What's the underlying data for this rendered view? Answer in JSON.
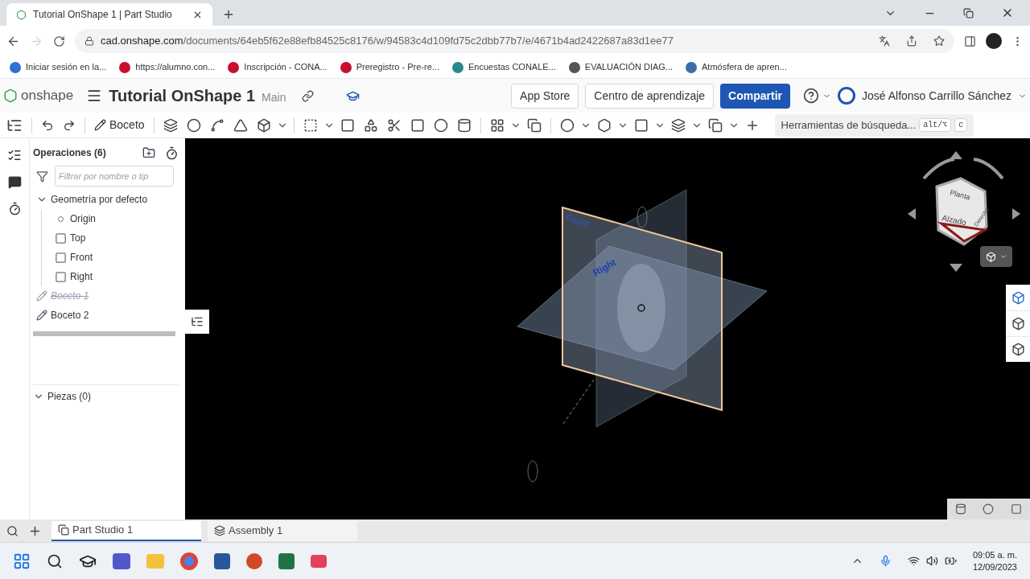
{
  "browser": {
    "tab_title": "Tutorial OnShape 1 | Part Studio",
    "url_host": "cad.onshape.com",
    "url_path": "/documents/64eb5f62e88efb84525c8176/w/94583c4d109fd75c2dbb77b7/e/4671b4ad2422687a83d1ee77",
    "bookmarks": [
      {
        "label": "Iniciar sesión en la...",
        "color": "#2f6fd6"
      },
      {
        "label": "https://alumno.con...",
        "color": "#c8102e"
      },
      {
        "label": "Inscripción - CONA...",
        "color": "#c8102e"
      },
      {
        "label": "Preregistro - Pre-re...",
        "color": "#c8102e"
      },
      {
        "label": "Encuestas CONALE...",
        "color": "#2a8a8a"
      },
      {
        "label": "EVALUACIÓN DIAG...",
        "color": "#555555"
      },
      {
        "label": "Atmósfera de apren...",
        "color": "#3a6ea5"
      }
    ]
  },
  "header": {
    "logo": "onshape",
    "document_title": "Tutorial OnShape 1",
    "branch": "Main",
    "buttons": [
      {
        "label": "App Store",
        "kind": "plain"
      },
      {
        "label": "Centro de aprendizaje",
        "kind": "plain"
      },
      {
        "label": "Compartir",
        "kind": "primary"
      }
    ],
    "user": "José Alfonso Carrillo Sánchez"
  },
  "toolbar": {
    "sketch_label": "Boceto",
    "search": "Herramientas de búsqueda...",
    "shortcut_keys": [
      "alt/⌥",
      "c"
    ]
  },
  "feature_list": {
    "title": "Operaciones (6)",
    "filter_placeholder": "Filtrar por nombre o tip",
    "items": [
      {
        "label": "Geometría por defecto",
        "kind": "group",
        "expanded": true,
        "children": [
          {
            "label": "Origin",
            "kind": "origin"
          },
          {
            "label": "Top",
            "kind": "plane"
          },
          {
            "label": "Front",
            "kind": "plane"
          },
          {
            "label": "Right",
            "kind": "plane"
          }
        ]
      },
      {
        "label": "Boceto 1",
        "kind": "sketch",
        "suppressed": true
      },
      {
        "label": "Boceto 2",
        "kind": "sketch",
        "suppressed": false
      }
    ],
    "parts": {
      "label": "Piezas (0)",
      "expanded": true
    }
  },
  "viewport": {
    "plane_labels": [
      "Front",
      "Right"
    ],
    "view_cube": [
      "Planta",
      "Alzado",
      "Derecha"
    ]
  },
  "bottom_tabs": [
    {
      "label": "Part Studio 1",
      "kind": "part_studio",
      "selected": true
    },
    {
      "label": "Assembly 1",
      "kind": "assembly",
      "selected": false
    }
  ],
  "taskbar": {
    "time": "09:05 a. m.",
    "date": "12/09/2023"
  }
}
